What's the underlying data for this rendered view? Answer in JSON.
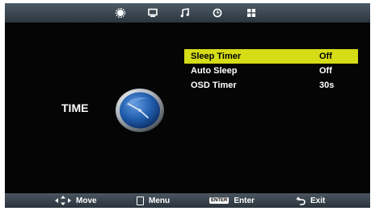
{
  "tabs": [
    {
      "icon": "picture-icon"
    },
    {
      "icon": "monitor-icon"
    },
    {
      "icon": "music-note-icon"
    },
    {
      "icon": "clock-icon"
    },
    {
      "icon": "grid-icon"
    }
  ],
  "active_tab": "clock-icon",
  "section": {
    "title": "TIME",
    "icon": "analog-clock-icon"
  },
  "menu": {
    "items": [
      {
        "label": "Sleep Timer",
        "value": "Off",
        "selected": true
      },
      {
        "label": "Auto Sleep",
        "value": "Off",
        "selected": false
      },
      {
        "label": "OSD Timer",
        "value": "30s",
        "selected": false
      }
    ]
  },
  "footer": {
    "move": "Move",
    "menu": "Menu",
    "enter_key": "ENTER",
    "enter": "Enter",
    "exit": "Exit"
  },
  "colors": {
    "highlight": "#d6dc16",
    "background": "#000000",
    "bar": "#3a4550",
    "clock_face": "#1e5aa8"
  }
}
